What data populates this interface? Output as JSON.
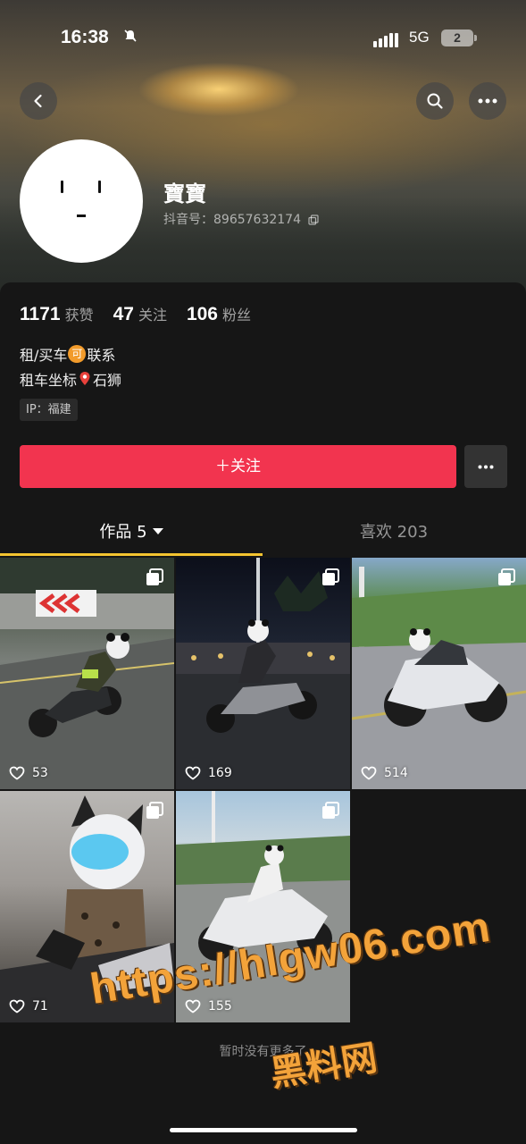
{
  "status_bar": {
    "time": "16:38",
    "network": "5G",
    "battery": "2"
  },
  "profile": {
    "nickname": "寶寶",
    "douyin_id_label": "抖音号：89657632174",
    "stats": [
      {
        "num": "1171",
        "label": "获赞"
      },
      {
        "num": "47",
        "label": "关注"
      },
      {
        "num": "106",
        "label": "粉丝"
      }
    ],
    "bio": {
      "line1_a": "租/买车",
      "line1_badge": "可",
      "line1_b": "联系",
      "line2_a": "租车坐标",
      "line2_b": "石狮"
    },
    "ip": "IP：福建"
  },
  "actions": {
    "follow_label": "＋关注"
  },
  "tabs": [
    {
      "label": "作品 5",
      "active": true
    },
    {
      "label": "喜欢 203",
      "active": false
    }
  ],
  "videos": [
    {
      "likes": "53"
    },
    {
      "likes": "169"
    },
    {
      "likes": "514"
    },
    {
      "likes": "71"
    },
    {
      "likes": "155"
    }
  ],
  "footer": {
    "no_more": "暂时没有更多了"
  },
  "watermark": {
    "url": "https://hlgw06.com",
    "text": "黑料网"
  },
  "colors": {
    "follow": "#f2344f",
    "tab_underline": "#f4c430",
    "background": "#161616"
  }
}
